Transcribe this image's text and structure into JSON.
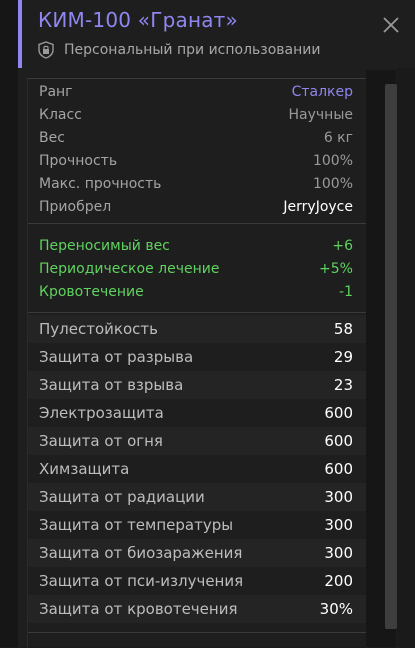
{
  "header": {
    "title": "КИМ-100 «Гранат»",
    "subtitle": "Персональный при использовании",
    "accent_color": "#8f86f0",
    "close_icon": "close-icon",
    "shield_icon": "shield-icon"
  },
  "info": [
    {
      "label": "Ранг",
      "value": "Сталкер"
    },
    {
      "label": "Класс",
      "value": "Научные"
    },
    {
      "label": "Вес",
      "value": "6 кг"
    },
    {
      "label": "Прочность",
      "value": "100%"
    },
    {
      "label": "Макс. прочность",
      "value": "100%"
    },
    {
      "label": "Приобрел",
      "value": "JerryJoyce"
    }
  ],
  "bonuses": [
    {
      "label": "Переносимый вес",
      "value": "+6"
    },
    {
      "label": "Периодическое лечение",
      "value": "+5%"
    },
    {
      "label": "Кровотечение",
      "value": "-1"
    }
  ],
  "protection": [
    {
      "label": "Пулестойкость",
      "value": "58"
    },
    {
      "label": "Защита от разрыва",
      "value": "29"
    },
    {
      "label": "Защита от взрыва",
      "value": "23"
    },
    {
      "label": "Электрозащита",
      "value": "600"
    },
    {
      "label": "Защита от огня",
      "value": "600"
    },
    {
      "label": "Химзащита",
      "value": "600"
    },
    {
      "label": "Защита от радиации",
      "value": "300"
    },
    {
      "label": "Защита от температуры",
      "value": "300"
    },
    {
      "label": "Защита от биозаражения",
      "value": "300"
    },
    {
      "label": "Защита от пси-излучения",
      "value": "200"
    },
    {
      "label": "Защита от кровотечения",
      "value": "30%"
    }
  ],
  "colors": {
    "bonus_green": "#5fd35f",
    "rank_purple": "#8f86f0"
  }
}
